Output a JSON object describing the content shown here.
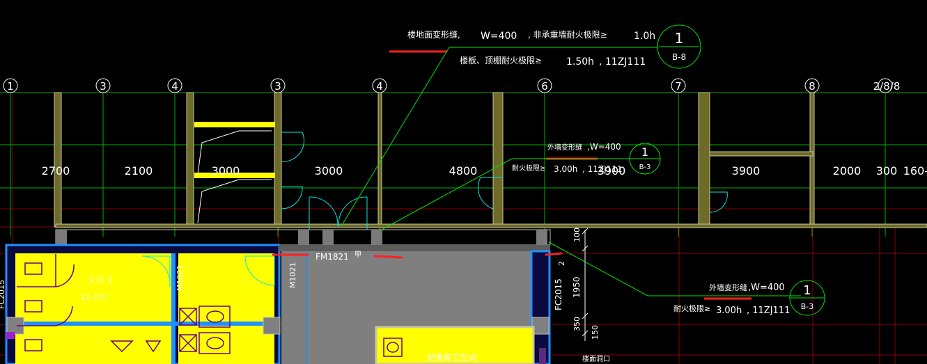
{
  "drawing": {
    "background": "#000000",
    "colors": {
      "gridline": "#00c000",
      "axis_bubble": "#ffffff",
      "wall_fill": "#6e6a28",
      "wall_edge": "#c8c8a0",
      "door_swing": "#00e6e6",
      "red_grid": "#a00000",
      "red_underline": "#ff2020",
      "yellow_room": "#ffff00",
      "grey_room": "#7f7f7f",
      "blue_wall": "#1e90ff",
      "leader": "#00ff00",
      "text_white": "#ffffff",
      "purple": "#9a20d0"
    }
  },
  "axes": [
    "1",
    "3",
    "4",
    "3",
    "4",
    "6",
    "7",
    "8",
    "2/8/8"
  ],
  "room_dims": [
    "2700",
    "2100",
    "3000",
    "3000",
    "4800",
    "3900",
    "3900",
    "2000",
    "300",
    "160–"
  ],
  "callouts": {
    "top": {
      "line1_label": "楼地面变形缝,",
      "line1_width": "W=400",
      "line1_rest": ", 非承重墙耐火极限≥",
      "line1_value": "1.0h",
      "line2_label": "楼板、顶棚耐火极限≥",
      "line2_value": "1.50h",
      "line2_ref": ", 11ZJ111",
      "detail_num": "1",
      "detail_sheet": "B-8"
    },
    "middle": {
      "label": "外墙变形缝",
      "width": ",W=400",
      "fire_label": "耐火极限≥",
      "fire_value": "3.00h",
      "ref": ", 11ZJ111",
      "detail_num": "1",
      "detail_sheet": "B-3"
    },
    "bottom": {
      "label": "外墙变形缝",
      "width": ",W=400",
      "fire_label": "耐火极限≥",
      "fire_value": "3.00h",
      "ref": ", 11ZJ111",
      "detail_num": "1",
      "detail_sheet": "B-3"
    }
  },
  "lower_plan": {
    "room_name": "女厕 2",
    "room_area": "10.0m²",
    "door_m1021_left": "M1021",
    "door_m1021_right": "M1021",
    "door_fm": "FM1821",
    "door_fm_suffix": "甲",
    "window_fc": "FC2015",
    "window_fc_left": "FC2015",
    "dim_100": "100",
    "dim_1950": "1950",
    "dim_350": "350",
    "dim_150": "150",
    "side_note": "楼面洞口",
    "side_num": "2",
    "lower_room_name": "无障碍卫生间"
  }
}
